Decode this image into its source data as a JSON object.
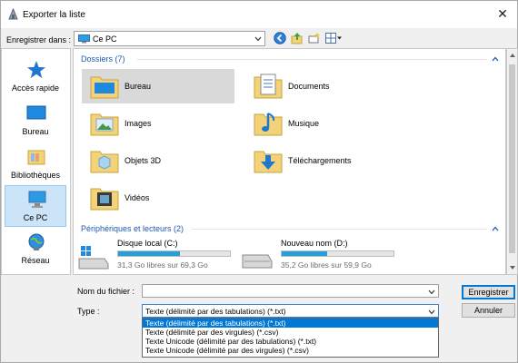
{
  "window": {
    "title": "Exporter la liste",
    "close_symbol": "✕"
  },
  "location": {
    "label": "Enregistrer dans :",
    "value": "Ce PC"
  },
  "places": [
    {
      "label": "Accès rapide",
      "icon": "star-icon",
      "selected": false
    },
    {
      "label": "Bureau",
      "icon": "desktop-icon",
      "selected": false
    },
    {
      "label": "Bibliothèques",
      "icon": "libraries-icon",
      "selected": false
    },
    {
      "label": "Ce PC",
      "icon": "computer-icon",
      "selected": true
    },
    {
      "label": "Réseau",
      "icon": "network-icon",
      "selected": false
    }
  ],
  "view": {
    "folders_header": "Dossiers (7)",
    "folders": [
      {
        "name": "Bureau",
        "icon": "desktop-folder-icon",
        "selected": true
      },
      {
        "name": "Documents",
        "icon": "documents-folder-icon",
        "selected": false
      },
      {
        "name": "Images",
        "icon": "pictures-folder-icon",
        "selected": false
      },
      {
        "name": "Musique",
        "icon": "music-folder-icon",
        "selected": false
      },
      {
        "name": "Objets 3D",
        "icon": "3d-objects-folder-icon",
        "selected": false
      },
      {
        "name": "Téléchargements",
        "icon": "downloads-folder-icon",
        "selected": false
      },
      {
        "name": "Vidéos",
        "icon": "videos-folder-icon",
        "selected": false
      }
    ],
    "drives_header": "Périphériques et lecteurs (2)",
    "drives": [
      {
        "name": "Disque local (C:)",
        "info": "31,3 Go libres sur 69,3 Go",
        "used_fraction": 0.55
      },
      {
        "name": "Nouveau nom (D:)",
        "info": "35,2 Go libres sur 59,9 Go",
        "used_fraction": 0.41
      }
    ]
  },
  "form": {
    "filename_label": "Nom du fichier :",
    "filename_value": "",
    "type_label": "Type :",
    "type_value": "Texte (délimité par des tabulations) (*.txt)",
    "type_options": [
      "Texte (délimité par des tabulations) (*.txt)",
      "Texte (délimité par des virgules) (*.csv)",
      "Texte Unicode (délimité par des tabulations) (*.txt)",
      "Texte Unicode (délimité par des virgules) (*.csv)"
    ]
  },
  "buttons": {
    "save": "Enregistrer",
    "cancel": "Annuler"
  },
  "colors": {
    "accent": "#0078d7",
    "group_header": "#1e5ab4",
    "drive_bar": "#26a0da",
    "folder": "#f4d27a"
  }
}
